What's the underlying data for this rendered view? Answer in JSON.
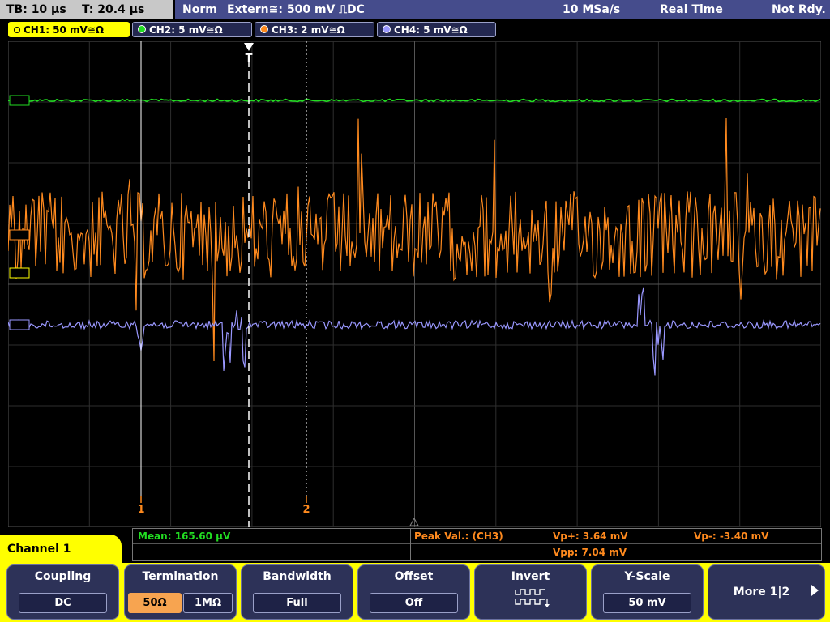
{
  "status": {
    "tb": "TB: 10 µs",
    "t": "T: 20.4 µs",
    "mode": "Norm",
    "trigger": "Extern≅: 500 mV ⎍DC",
    "sample_rate": "10 MSa/s",
    "acq": "Real Time",
    "state": "Not Rdy."
  },
  "channels": [
    {
      "label": "CH1: 50 mV≅Ω",
      "color": "#ffff00",
      "active": true
    },
    {
      "label": "CH2: 5 mV≅Ω",
      "color": "#22dd22",
      "active": false
    },
    {
      "label": "CH3: 2 mV≅Ω",
      "color": "#ff8a1e",
      "active": false
    },
    {
      "label": "CH4: 5 mV≅Ω",
      "color": "#9a98ff",
      "active": false
    }
  ],
  "cursors": {
    "c1": "1",
    "c2": "2",
    "trigger": "T"
  },
  "measure": {
    "mean": "Mean: 165.60 µV",
    "peak": "Peak Val.:  (CH3)",
    "vp_plus": "Vp+: 3.64 mV",
    "vp_minus": "Vp-: -3.40 mV",
    "vpp": "Vpp: 7.04 mV"
  },
  "channel_menu": "Channel 1",
  "softkeys": {
    "coupling": {
      "label": "Coupling",
      "value": "DC"
    },
    "termination": {
      "label": "Termination",
      "opt1": "50Ω",
      "opt2": "1MΩ"
    },
    "bandwidth": {
      "label": "Bandwidth",
      "value": "Full"
    },
    "offset": {
      "label": "Offset",
      "value": "Off"
    },
    "invert": {
      "label": "Invert"
    },
    "yscale": {
      "label": "Y-Scale",
      "value": "50 mV"
    },
    "more": {
      "label": "More 1|2"
    }
  }
}
